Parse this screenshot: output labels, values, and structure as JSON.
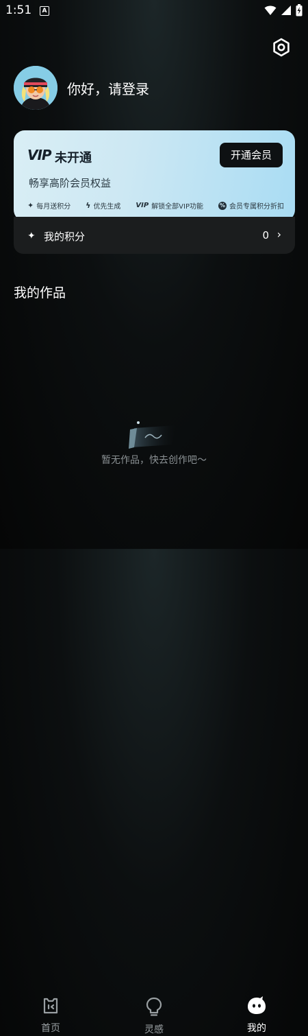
{
  "status": {
    "time": "1:51",
    "a_badge": "A"
  },
  "profile": {
    "greeting": "你好，请登录"
  },
  "vip": {
    "logo": "VIP",
    "status": "未开通",
    "button": "开通会员",
    "description": "畅享高阶会员权益",
    "perks": [
      {
        "icon": "sparkle-icon",
        "label": "每月送积分"
      },
      {
        "icon": "bolt-icon",
        "label": "优先生成"
      },
      {
        "icon": "vip-icon",
        "label": "解锁全部VIP功能"
      },
      {
        "icon": "discount-icon",
        "label": "会员专属积分折扣"
      }
    ],
    "perk_icon_glyphs": [
      "✦",
      "ϟ",
      "VIP",
      "%"
    ]
  },
  "points": {
    "label": "我的积分",
    "value": "0"
  },
  "works": {
    "title": "我的作品",
    "empty_text": "暂无作品，快去创作吧～"
  },
  "tabs": [
    {
      "label": "首页",
      "icon": "home-icon",
      "active": false
    },
    {
      "label": "灵感",
      "icon": "bulb-icon",
      "active": false
    },
    {
      "label": "我的",
      "icon": "mine-icon",
      "active": true
    }
  ],
  "colors": {
    "tab_inactive": "#9aa0a3",
    "tab_active": "#ffffff",
    "vip_button": "#0e1113"
  }
}
